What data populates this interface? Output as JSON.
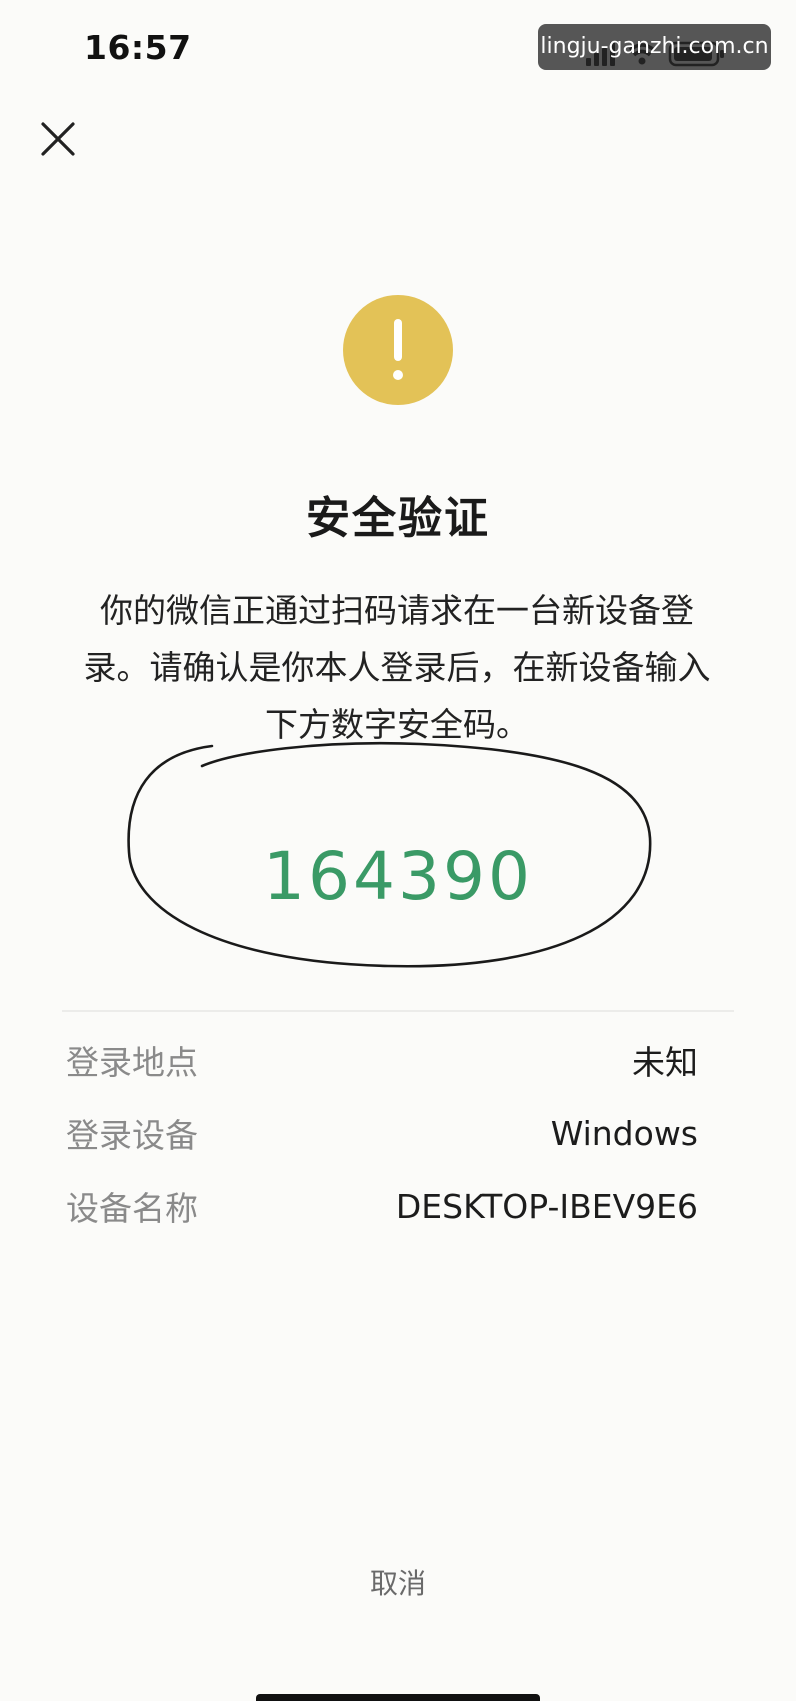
{
  "status_bar": {
    "time": "16:57"
  },
  "watermark": {
    "text": "lingju-ganzhi.com.cn"
  },
  "dialog": {
    "title": "安全验证",
    "description": "你的微信正通过扫码请求在一台新设备登录。请确认是你本人登录后，在新设备输入下方数字安全码。",
    "security_code": "164390",
    "code_color": "#3a9a66",
    "warning_color": "#e3c257",
    "info": [
      {
        "label": "登录地点",
        "value": "未知"
      },
      {
        "label": "登录设备",
        "value": "Windows"
      },
      {
        "label": "设备名称",
        "value": "DESKTOP-IBEV9E6"
      }
    ],
    "cancel_label": "取消"
  },
  "icons": {
    "close": "close-icon",
    "warning": "warning-icon",
    "signal": "signal-icon",
    "wifi": "wifi-icon",
    "battery": "battery-icon"
  }
}
